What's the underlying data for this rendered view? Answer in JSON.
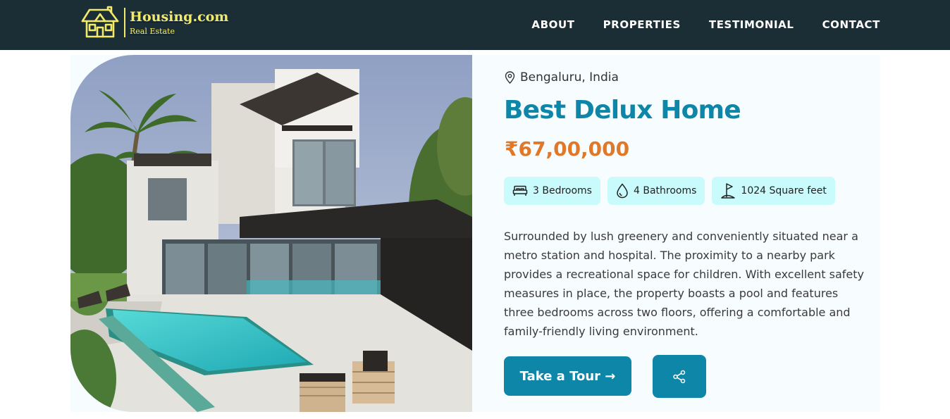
{
  "brand": {
    "name": "Housing.com",
    "tagline": "Real Estate",
    "logo_icon": "house-icon",
    "color": "#f3e96a"
  },
  "nav": {
    "items": [
      {
        "label": "ABOUT"
      },
      {
        "label": "PROPERTIES"
      },
      {
        "label": "TESTIMONIAL"
      },
      {
        "label": "CONTACT"
      }
    ]
  },
  "property": {
    "location": "Bengaluru, India",
    "location_icon": "map-pin-icon",
    "title": "Best Delux Home",
    "price": "₹67,00,000",
    "features": [
      {
        "icon": "bed-icon",
        "label": "3 Bedrooms"
      },
      {
        "icon": "water-drop-icon",
        "label": "4 Bathrooms"
      },
      {
        "icon": "flag-icon",
        "label": "1024 Square feet"
      }
    ],
    "description": "Surrounded by lush greenery and conveniently situated near a metro station and hospital. The proximity to a nearby park provides a recreational space for children. With excellent safety measures in place, the property boasts a pool and features three bedrooms across two floors, offering a comfortable and family-friendly living environment.",
    "photo_alt": "Modern villa with swimming pool"
  },
  "actions": {
    "tour_label": "Take a Tour →",
    "share_icon": "share-icon"
  },
  "colors": {
    "navbar": "#1c2e35",
    "accent": "#0e86a8",
    "price": "#e0782a",
    "badge": "#c9fbfc"
  }
}
